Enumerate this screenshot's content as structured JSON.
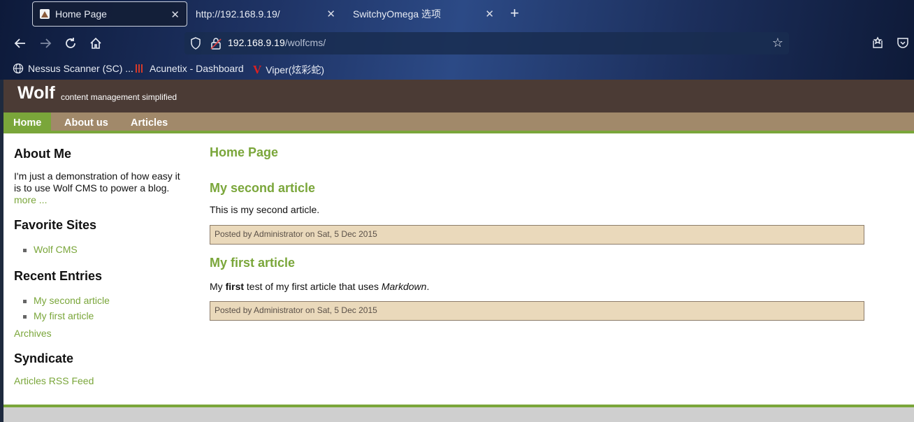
{
  "browser": {
    "tabs": [
      {
        "title": "Home Page",
        "active": true
      },
      {
        "title": "http://192.168.9.19/",
        "active": false
      },
      {
        "title": "SwitchyOmega 选项",
        "active": false
      }
    ],
    "url_host": "192.168.9.19",
    "url_path": "/wolfcms/",
    "bookmarks": [
      {
        "label": "Nessus Scanner (SC) ...",
        "icon": "globe-icon"
      },
      {
        "label": "Acunetix - Dashboard",
        "icon": "acunetix-icon"
      },
      {
        "label": "Viper(炫彩蛇)",
        "icon": "viper-icon"
      }
    ]
  },
  "site": {
    "title": "Wolf",
    "tagline": "content management simplified",
    "menu": [
      "Home",
      "About us",
      "Articles"
    ]
  },
  "sidebar": {
    "about_heading": "About Me",
    "about_text": "I'm just a demonstration of how easy it is to use Wolf CMS to power a blog.",
    "more_link": "more ...",
    "favorites_heading": "Favorite Sites",
    "favorites": [
      "Wolf CMS"
    ],
    "recent_heading": "Recent Entries",
    "recent": [
      "My second article",
      "My first article"
    ],
    "archives_link": "Archives",
    "syndicate_heading": "Syndicate",
    "rss_link": "Articles RSS Feed"
  },
  "content": {
    "page_title": "Home Page",
    "articles": [
      {
        "title": "My second article",
        "body": "This is my second article.",
        "info": "Posted by Administrator on Sat, 5 Dec 2015"
      },
      {
        "title": "My first article",
        "body_pre": "My ",
        "body_bold": "first",
        "body_mid": " test of my first article that uses ",
        "body_em": "Markdown",
        "body_post": ".",
        "info": "Posted by Administrator on Sat, 5 Dec 2015"
      }
    ]
  },
  "colors": {
    "accent_green": "#7aa63a",
    "header_brown": "#4b3b35",
    "menu_tan": "#a1896a",
    "info_bg": "#ead9bb"
  }
}
